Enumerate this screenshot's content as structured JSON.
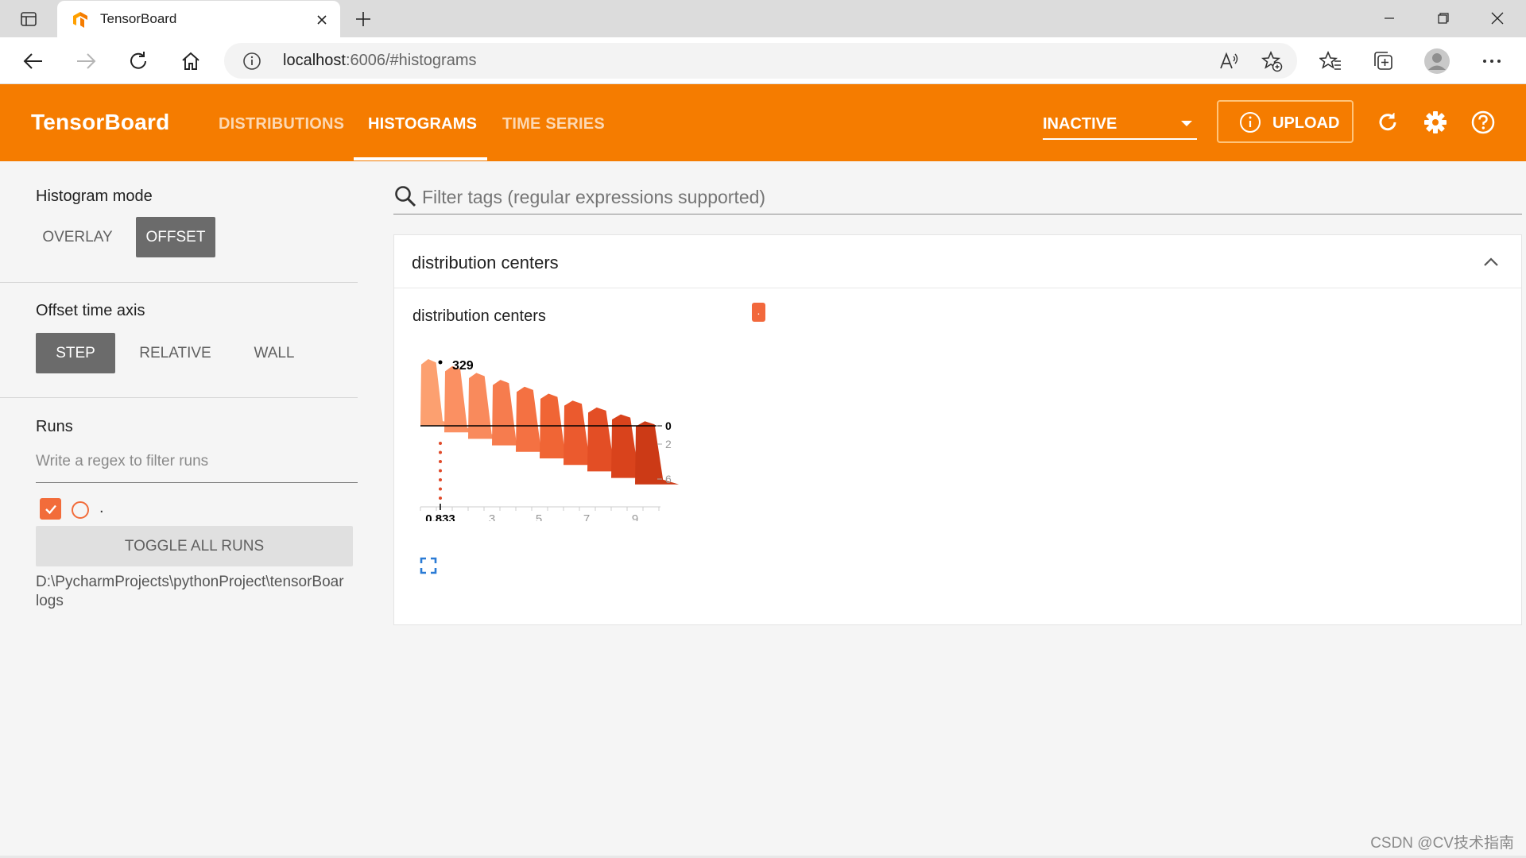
{
  "browser": {
    "tab_title": "TensorBoard",
    "url_host": "localhost",
    "url_rest": ":6006/#histograms"
  },
  "header": {
    "brand": "TensorBoard",
    "tabs": [
      {
        "label": "DISTRIBUTIONS"
      },
      {
        "label": "HISTOGRAMS"
      },
      {
        "label": "TIME SERIES"
      }
    ],
    "active_tab": "HISTOGRAMS",
    "selector_label": "INACTIVE",
    "upload_label": "UPLOAD",
    "accent_color": "#f57c00"
  },
  "sidebar": {
    "histogram_mode": {
      "heading": "Histogram mode",
      "options": [
        "OVERLAY",
        "OFFSET"
      ],
      "selected": "OFFSET"
    },
    "offset_time_axis": {
      "heading": "Offset time axis",
      "options": [
        "STEP",
        "RELATIVE",
        "WALL"
      ],
      "selected": "STEP"
    },
    "runs": {
      "heading": "Runs",
      "filter_placeholder": "Write a regex to filter runs",
      "items": [
        {
          "name": ".",
          "checked": true,
          "color": "#f26c3a"
        }
      ],
      "toggle_all_label": "TOGGLE ALL RUNS",
      "logdir_line1": "D:\\PycharmProjects\\pythonProject\\tensorBoar",
      "logdir_line2": "logs"
    }
  },
  "main": {
    "filter_placeholder": "Filter tags (regular expressions supported)",
    "card": {
      "title": "distribution centers",
      "plot_title": "distribution centers",
      "run_badge": "."
    }
  },
  "chart_data": {
    "type": "histogram-offset",
    "title": "distribution centers",
    "x_ticks": [
      "0.833",
      "3",
      "5",
      "7",
      "9"
    ],
    "y_ticks": [
      "0",
      "2",
      "6"
    ],
    "hover_value": "329",
    "hover_x": "0.833",
    "steps": 10,
    "series_colors": [
      "#fca070",
      "#fb9062",
      "#f98a5c",
      "#f67c4e",
      "#f47142",
      "#f06535",
      "#eb5a2e",
      "#e34e25",
      "#d9431c",
      "#cc3a16"
    ]
  },
  "watermark": "CSDN @CV技术指南"
}
